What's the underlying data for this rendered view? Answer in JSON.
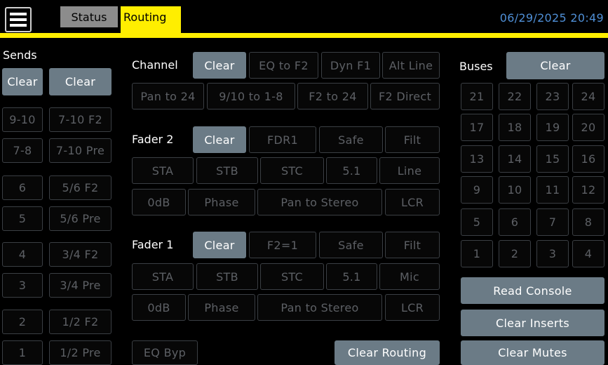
{
  "header": {
    "tabs": [
      "Status",
      "Routing"
    ],
    "datetime": "06/29/2025 20:49"
  },
  "sends": {
    "title": "Sends",
    "clear_left": "Clear",
    "clear_right": "Clear",
    "left": [
      "9-10",
      "7-8",
      "6",
      "5",
      "4",
      "3",
      "2",
      "1"
    ],
    "right": [
      "7-10 F2",
      "7-10 Pre",
      "5/6 F2",
      "5/6 Pre",
      "3/4 F2",
      "3/4 Pre",
      "1/2 F2",
      "1/2 Pre"
    ]
  },
  "channel": {
    "title": "Channel",
    "row1": [
      "Clear",
      "EQ to F2",
      "Dyn F1",
      "Alt Line"
    ],
    "row2": [
      "Pan to 24",
      "9/10 to 1-8",
      "F2 to 24",
      "F2 Direct"
    ]
  },
  "fader2": {
    "title": "Fader 2",
    "row1": [
      "Clear",
      "FDR1",
      "Safe",
      "Filt"
    ],
    "row2": [
      "STA",
      "STB",
      "STC",
      "5.1",
      "Line"
    ],
    "row3": [
      "0dB",
      "Phase",
      "Pan to Stereo",
      "LCR"
    ]
  },
  "fader1": {
    "title": "Fader 1",
    "row1": [
      "Clear",
      "F2=1",
      "Safe",
      "Filt"
    ],
    "row2": [
      "STA",
      "STB",
      "STC",
      "5.1",
      "Mic"
    ],
    "row3": [
      "0dB",
      "Phase",
      "Pan to Stereo",
      "LCR"
    ]
  },
  "bottom": {
    "eq_byp": "EQ Byp",
    "clear_routing": "Clear Routing"
  },
  "buses": {
    "title": "Buses",
    "clear": "Clear",
    "rows": [
      [
        "21",
        "22",
        "23",
        "24"
      ],
      [
        "17",
        "18",
        "19",
        "20"
      ],
      [
        "13",
        "14",
        "15",
        "16"
      ],
      [
        "9",
        "10",
        "11",
        "12"
      ],
      [
        "5",
        "6",
        "7",
        "8"
      ],
      [
        "1",
        "2",
        "3",
        "4"
      ]
    ],
    "read_console": "Read Console",
    "clear_inserts": "Clear Inserts",
    "clear_mutes": "Clear Mutes"
  },
  "colors": {
    "accent_yellow": "#ffee00",
    "active_button": "#6b7b86",
    "inactive_text": "#5d6065",
    "datetime_blue": "#4f8fd6"
  }
}
